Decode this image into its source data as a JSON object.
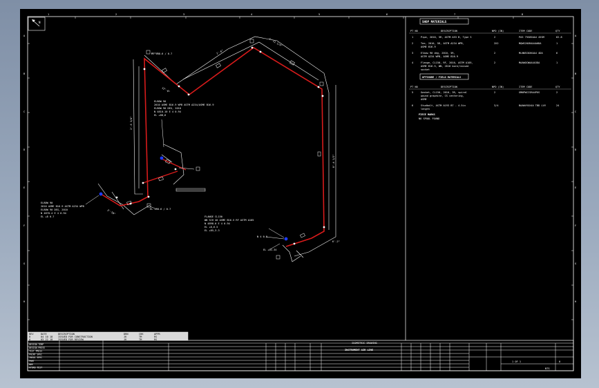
{
  "colors": {
    "pipe": "#d81b1b",
    "fitting": "#1e3cff",
    "line": "#ffffff",
    "background": "#000000"
  },
  "border": {
    "top_numbers": [
      "1",
      "2",
      "3",
      "4",
      "5",
      "6",
      "7",
      "8"
    ],
    "left_letters": [
      "A",
      "B",
      "C",
      "D",
      "E",
      "F",
      "G",
      "H"
    ]
  },
  "north_arrow": {
    "icon": "north-arrow-icon",
    "label": "N"
  },
  "bom": {
    "shop_header": "SHOP MATERIALS",
    "columns": {
      "pt_no": "PT NO",
      "description": "DESCRIPTION",
      "npd": "NPD (IN)",
      "item_code": "ITEM CODE",
      "qty": "QTY"
    },
    "shop_items": [
      {
        "pt": "1",
        "desc": [
          "Pipe, 2010, 5R, ASTM A53 B, Type S"
        ],
        "npd": "2",
        "code": "PA5 75S05AA4 45SM",
        "qty": "62.8"
      },
      {
        "pt": "2",
        "desc": [
          "Tee, 2010, 5R, ASTM A234 WPB,",
          "ASME B16.9"
        ],
        "npd": "2X2",
        "code": "MQWS20XRAA4A0DA",
        "qty": "1"
      },
      {
        "pt": "3",
        "desc": [
          "Elbow 90 deg, 2010, 5R,",
          "ASTM A234 WPB, ASME B16.9"
        ],
        "npd": "2",
        "code": "MLNW5I0XKAA4 4DA",
        "qty": "6"
      },
      {
        "pt": "4",
        "desc": [
          "Flange, CL150, RF, 2010, ASTM A105,",
          "ASME B16.5, WN, 2010 bore/raised",
          "socket"
        ],
        "npd": "2",
        "code": "MAAWOCWAA4A3DA",
        "qty": "1"
      }
    ],
    "offshop_header": "OFFSHORE / FIELD MATERIALS",
    "offshop_items": [
      {
        "pt": "5",
        "desc": [
          "Gasket, CL150, 2010, 3R, spiral",
          "wound graphite, CS centering,",
          "ASME"
        ],
        "npd": "2",
        "code": "GMNFWCCSRA4PUS",
        "qty": "2"
      },
      {
        "pt": "6",
        "desc": [
          "Studbolt, ASTM A193 B7 - 4.5in",
          "length"
        ],
        "npd": "3/4",
        "code": "BAAWVVXX4A TBD LVV",
        "qty": "24"
      }
    ],
    "piece_marks_label": "PIECE MARKS",
    "piece_marks_value": "NO SPOOL FOUND"
  },
  "annotations": [
    {
      "lines": [
        "ELBOW 90",
        "2010 ASME B16.9 WPB ASTM A234/ASME B16.9",
        "ELBOW 90 DEG, 2010",
        "N 4810.10 E 4 0.94",
        "EL +88,6"
      ]
    },
    {
      "lines": [
        "ELBOW 90",
        "2010 ASME B16.9 ASTM A234 WPB",
        "ELBOW 90 DEG, 2010",
        "N 4870.4 E 4 0.94",
        "EL +8 0.7"
      ]
    },
    {
      "lines": [
        "FLANGE CL150",
        "WN SCH 40 ASME B16.5 RF ASTM A105",
        "N 4898.0 E 4 0.94",
        "EL +8,6.5",
        "EL +85,3.3"
      ]
    },
    {
      "lines": [
        "EL +88.6 / 0.7"
      ]
    },
    {
      "lines": [
        "EL +90.6 / 0.7"
      ]
    },
    {
      "lines": [
        "N 4 0.5"
      ]
    },
    {
      "lines": [
        "EL +81.34"
      ]
    }
  ],
  "dimensions": [
    "2'-6 3/4\"",
    "8'-4 1/2\"",
    "12'-0\"",
    "4'-11 1/4\"",
    "1'-6\"",
    "6'-2\"",
    "3'-10\""
  ],
  "revision_table": {
    "headers": [
      "REV",
      "DATE",
      "DESCRIPTION",
      "DRN",
      "CHK",
      "APPR"
    ],
    "rows": [
      [
        "0",
        "04 10 18",
        "ISSUED FOR CONSTRUCTION",
        "JK",
        "TM",
        "RS"
      ],
      [
        "A",
        "03 22 18",
        "ISSUED FOR REVIEW",
        "JK",
        "TM",
        "RS"
      ]
    ]
  },
  "title_block": {
    "drawing_title": "ISOMETRIC DRAWING",
    "line_title": "INSTRUMENT AIR LINE",
    "fields": [
      "DESIGN TEMP",
      "DESIGN PRESS",
      "TEST PRESS",
      "PAINT SPEC",
      "INSUL SPEC",
      "PWHT",
      "NDE",
      "HYDRO TEST",
      "LINE CLASS"
    ],
    "sheet": "1 OF 1",
    "rev": "0",
    "scale": "NTS"
  }
}
